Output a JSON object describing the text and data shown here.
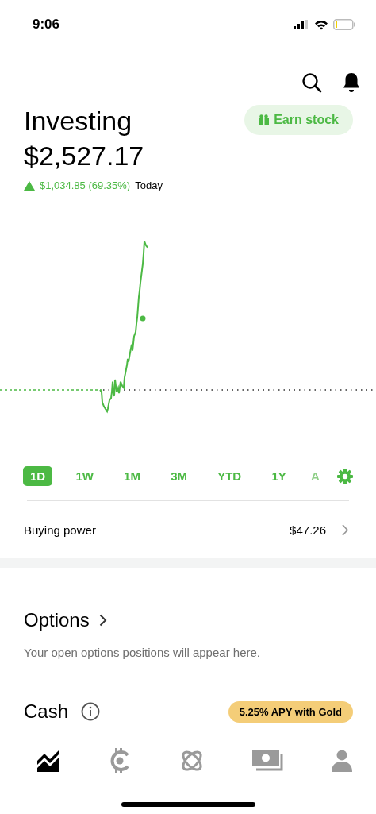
{
  "status_bar": {
    "time": "9:06"
  },
  "header": {
    "title": "Investing",
    "value": "$2,527.17",
    "earn_button": "Earn stock",
    "change": {
      "amount": "$1,034.85 (69.35%)",
      "period": "Today",
      "up": true
    }
  },
  "ranges": [
    {
      "label": "1D",
      "selected": true,
      "faded": false
    },
    {
      "label": "1W",
      "selected": false,
      "faded": false
    },
    {
      "label": "1M",
      "selected": false,
      "faded": false
    },
    {
      "label": "3M",
      "selected": false,
      "faded": false
    },
    {
      "label": "YTD",
      "selected": false,
      "faded": false
    },
    {
      "label": "1Y",
      "selected": false,
      "faded": false
    },
    {
      "label": "A",
      "selected": false,
      "faded": true
    }
  ],
  "buying_power": {
    "label": "Buying power",
    "value": "$47.26"
  },
  "options": {
    "title": "Options",
    "text": "Your open options positions will appear here."
  },
  "cash": {
    "title": "Cash",
    "badge": "5.25% APY with Gold"
  },
  "nav": [
    {
      "kind": "investing",
      "selected": true
    },
    {
      "kind": "crypto",
      "selected": false
    },
    {
      "kind": "orbit",
      "selected": false
    },
    {
      "kind": "money",
      "selected": false
    },
    {
      "kind": "account",
      "selected": false
    }
  ]
}
